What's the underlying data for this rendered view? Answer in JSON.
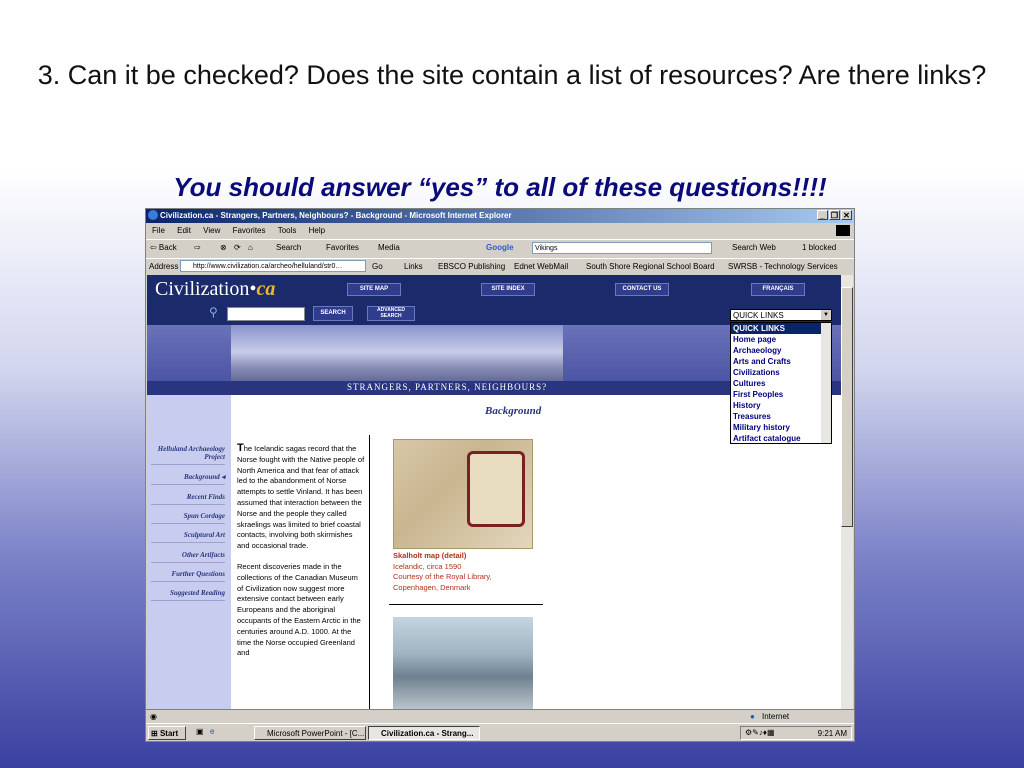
{
  "slide": {
    "title": "3. Can it be checked? Does the site contain a list of resources? Are there links?",
    "subtitle": "You should answer “yes” to all of these questions!!!!"
  },
  "window": {
    "title": "Civilization.ca - Strangers, Partners, Neighbours? - Background - Microsoft Internet Explorer",
    "min": "_",
    "max": "❐",
    "close": "✕"
  },
  "menu": [
    "File",
    "Edit",
    "View",
    "Favorites",
    "Tools",
    "Help"
  ],
  "toolbar": {
    "back": "⇦ Back",
    "forward": "⇨",
    "stop": "⊗",
    "refresh": "⟳",
    "home": "⌂",
    "search": "Search",
    "favorites": "Favorites",
    "media": "Media",
    "google": "Google",
    "google_value": "Vikings",
    "search_web": "Search Web",
    "blocked": "1 blocked"
  },
  "address": {
    "label": "Address",
    "url": "http://www.civilization.ca/archeo/helluland/str0…",
    "go": "Go",
    "links_label": "Links",
    "links": [
      "EBSCO Publishing",
      "Ednet WebMail",
      "South Shore Regional School Board",
      "SWRSB - Technology Services"
    ]
  },
  "site": {
    "logo_main": "Civilization",
    "logo_ca": "ca",
    "nav": [
      "SITE MAP",
      "SITE INDEX",
      "CONTACT US",
      "FRANÇAIS"
    ],
    "search_btn": "SEARCH",
    "advanced_btn": "ADVANCED SEARCH",
    "banner": "STRANGERS, PARTNERS, NEIGHBOURS?",
    "heading": "Background",
    "sidebar": [
      "Helluland Archaeology Project",
      "Background ◂",
      "Recent Finds",
      "Spun Cordage",
      "Sculptural Art",
      "Other Artifacts",
      "Further Questions",
      "Suggested Reading"
    ],
    "para1_cap": "T",
    "para1": "he Icelandic sagas record that the Norse fought with the Native people of North America and that fear of attack led to the abandonment of Norse attempts to settle Vinland. It has been assumed that interaction between the Norse and the people they called skraelings was limited to brief coastal contacts, involving both skirmishes and occasional trade.",
    "para2": "Recent discoveries made in the collections of the Canadian Museum of Civilization now suggest more extensive contact between early Europeans and the aboriginal occupants of the Eastern Arctic in the centuries around A.D. 1000. At the time the Norse occupied Greenland and",
    "caption_title": "Skalholt map (detail)",
    "caption_lines": [
      "Icelandic, circa 1590",
      "Courtesy of the Royal Library,",
      "Copenhagen, Denmark"
    ],
    "quicklinks_label": "QUICK LINKS",
    "quicklinks": [
      "QUICK LINKS",
      "Home page",
      "Archaeology",
      "Arts and Crafts",
      "Civilizations",
      "Cultures",
      "First Peoples",
      "History",
      "Treasures",
      "Military history",
      "Artifact catalogue"
    ]
  },
  "status": {
    "zone": "Internet"
  },
  "taskbar": {
    "start": "Start",
    "tasks": [
      "Microsoft PowerPoint - [C...",
      "Civilization.ca - Strang..."
    ],
    "time": "9:21 AM"
  }
}
